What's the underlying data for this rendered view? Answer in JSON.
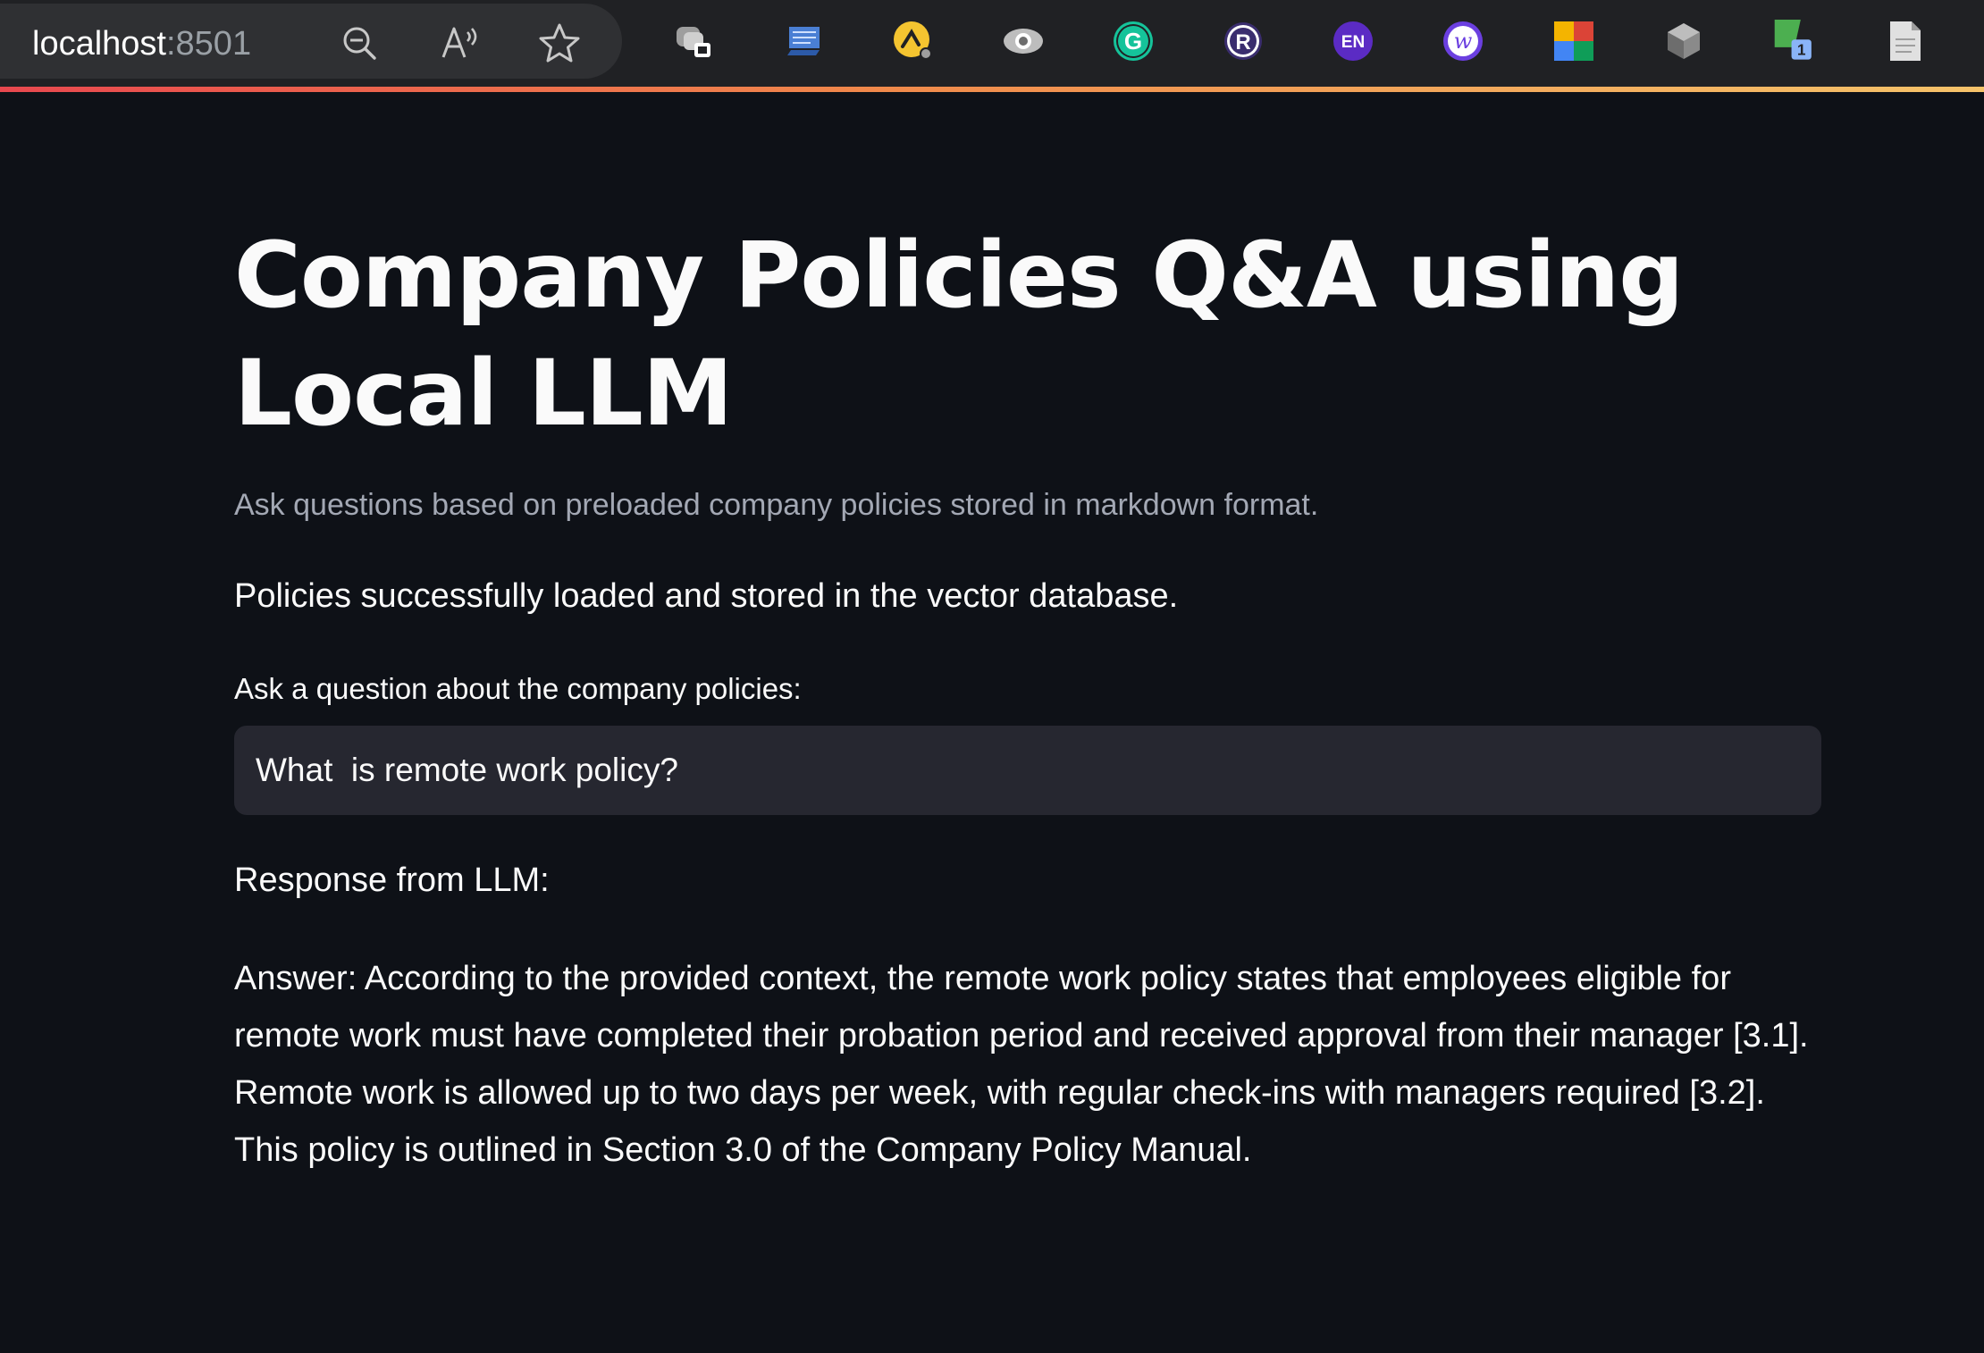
{
  "browser": {
    "url_host": "localhost",
    "url_port": ":8501",
    "address_icons": [
      "zoom-out-icon",
      "read-aloud-icon",
      "favorite-star-icon"
    ],
    "extensions": [
      {
        "name": "collections-extension-icon"
      },
      {
        "name": "notes-extension-icon"
      },
      {
        "name": "arc-extension-icon"
      },
      {
        "name": "eye-extension-icon"
      },
      {
        "name": "grammarly-extension-icon",
        "text": "G"
      },
      {
        "name": "r-extension-icon",
        "text": "R"
      },
      {
        "name": "language-extension-icon",
        "text": "EN"
      },
      {
        "name": "w-extension-icon",
        "text": "w"
      },
      {
        "name": "colorful-extension-icon"
      },
      {
        "name": "cube-extension-icon"
      },
      {
        "name": "sheet-extension-icon",
        "badge": "1"
      },
      {
        "name": "page-extension-icon"
      }
    ],
    "colors": {
      "toolbar": "#202124",
      "address_pill": "#2f3033",
      "grammarly": "#15c39a",
      "language": "#5b2bc4",
      "w_ext": "#6b3fe0",
      "badge": "#8ab4f8"
    }
  },
  "app": {
    "title": "Company Policies Q&A using Local LLM",
    "subtitle": "Ask questions based on preloaded company policies stored in markdown format.",
    "status": "Policies successfully loaded and stored in the vector database.",
    "question_label": "Ask a question about the company policies:",
    "question_value": "What  is remote work policy?",
    "response_label": "Response from LLM:",
    "answer": "Answer: According to the provided context, the remote work policy states that employees eligible for remote work must have completed their probation period and received approval from their manager [3.1]. Remote work is allowed up to two days per week, with regular check-ins with managers required [3.2]. This policy is outlined in Section 3.0 of the Company Policy Manual.",
    "colors": {
      "background": "#0e1117",
      "text": "#fafafa",
      "muted": "#a3a8b4",
      "input_bg": "#262730"
    }
  }
}
